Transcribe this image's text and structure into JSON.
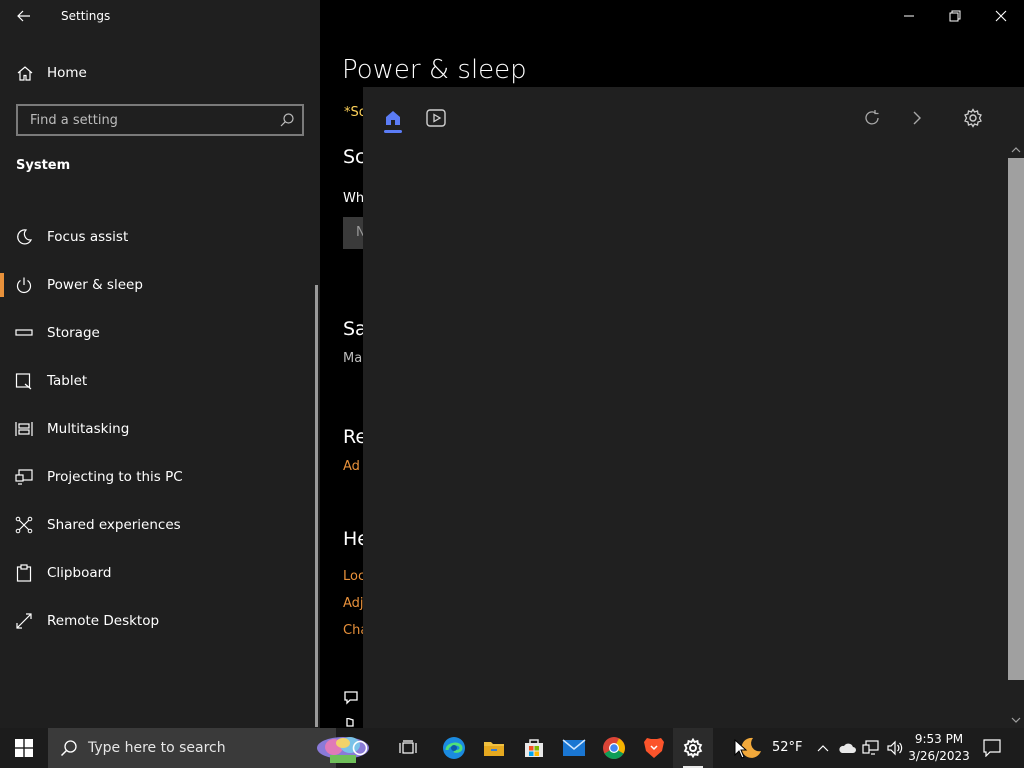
{
  "window": {
    "title": "Settings"
  },
  "sidebar": {
    "home_label": "Home",
    "search_placeholder": "Find a setting",
    "section_heading": "System",
    "items": [
      {
        "label": "Focus assist",
        "icon": "moon-icon"
      },
      {
        "label": "Power & sleep",
        "icon": "power-icon",
        "selected": true
      },
      {
        "label": "Storage",
        "icon": "storage-icon"
      },
      {
        "label": "Tablet",
        "icon": "tablet-icon"
      },
      {
        "label": "Multitasking",
        "icon": "multitasking-icon"
      },
      {
        "label": "Projecting to this PC",
        "icon": "projecting-icon"
      },
      {
        "label": "Shared experiences",
        "icon": "shared-experiences-icon"
      },
      {
        "label": "Clipboard",
        "icon": "clipboard-icon"
      },
      {
        "label": "Remote Desktop",
        "icon": "remote-desktop-icon"
      }
    ]
  },
  "main": {
    "page_title": "Power & sleep",
    "fragments": {
      "note": "*So",
      "screen_heading": "Sc",
      "screen_label": "Wh",
      "dropdown_value": "N",
      "sleep_heading": "Sa",
      "sleep_text": "Ma",
      "related_heading": "Re",
      "related_link": "Ad",
      "help_heading": "He",
      "help_link_1": "Loc",
      "help_link_2": "Adj",
      "help_link_3": "Cha"
    }
  },
  "overlay": {
    "tabs": [
      {
        "icon": "home-icon",
        "active": true
      },
      {
        "icon": "video-icon",
        "active": false
      }
    ],
    "accent": "#5b7cf6"
  },
  "taskbar": {
    "search_placeholder": "Type here to search",
    "weather": "52°F",
    "time": "9:53 PM",
    "date": "3/26/2023"
  },
  "colors": {
    "accent_orange": "#e8913b",
    "sidebar_bg": "#1f1f1f",
    "overlay_bg": "#202020"
  }
}
